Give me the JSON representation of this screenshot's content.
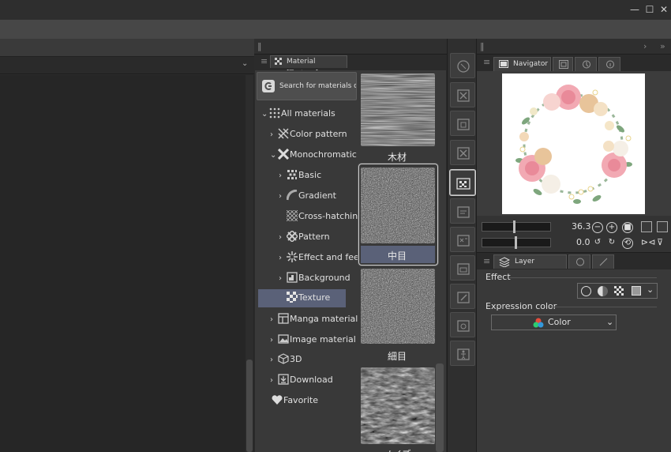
{
  "window": {
    "minimize_glyph": "—",
    "maximize_glyph": "☐",
    "close_glyph": "✕"
  },
  "material_panel": {
    "tab_label": "Material [Texture]",
    "search_button": "Search for materials on ASSETS",
    "tree": [
      {
        "label": "All materials",
        "icon": "dots-grid-icon",
        "chevron": "⌄"
      },
      {
        "label": "Color pattern",
        "icon": "color-pattern-icon",
        "chevron": "›"
      },
      {
        "label": "Monochromatic pattern",
        "icon": "mono-pattern-icon",
        "chevron": "⌄"
      },
      {
        "label": "Basic",
        "icon": "basic-icon",
        "chevron": "›"
      },
      {
        "label": "Gradient",
        "icon": "gradient-icon",
        "chevron": "›"
      },
      {
        "label": "Cross-hatching",
        "icon": "cross-hatch-icon",
        "chevron": ""
      },
      {
        "label": "Pattern",
        "icon": "pattern-icon",
        "chevron": "›"
      },
      {
        "label": "Effect and feeling",
        "icon": "effect-icon",
        "chevron": "›"
      },
      {
        "label": "Background",
        "icon": "background-icon",
        "chevron": "›"
      },
      {
        "label": "Texture",
        "icon": "texture-icon",
        "chevron": ""
      },
      {
        "label": "Manga material",
        "icon": "manga-icon",
        "chevron": "›"
      },
      {
        "label": "Image material",
        "icon": "image-icon",
        "chevron": "›"
      },
      {
        "label": "3D",
        "icon": "cube-icon",
        "chevron": "›"
      },
      {
        "label": "Download",
        "icon": "download-icon",
        "chevron": "›"
      },
      {
        "label": "Favorite",
        "icon": "heart-icon",
        "chevron": ""
      }
    ],
    "thumbnails": [
      {
        "label": "木材"
      },
      {
        "label": "中目"
      },
      {
        "label": "細目"
      },
      {
        "label": "ノイズ"
      }
    ]
  },
  "navigator": {
    "tab_label": "Navigator",
    "zoom": "36.3",
    "rotation": "0.0"
  },
  "layer_property": {
    "tab_label": "Layer Property",
    "effect_label": "Effect",
    "expression_color_label": "Expression color",
    "expression_color_value": "Color"
  },
  "colors": {
    "selection": "#5a6178",
    "panel": "#393939",
    "accent_border": "#cfcfcf"
  }
}
